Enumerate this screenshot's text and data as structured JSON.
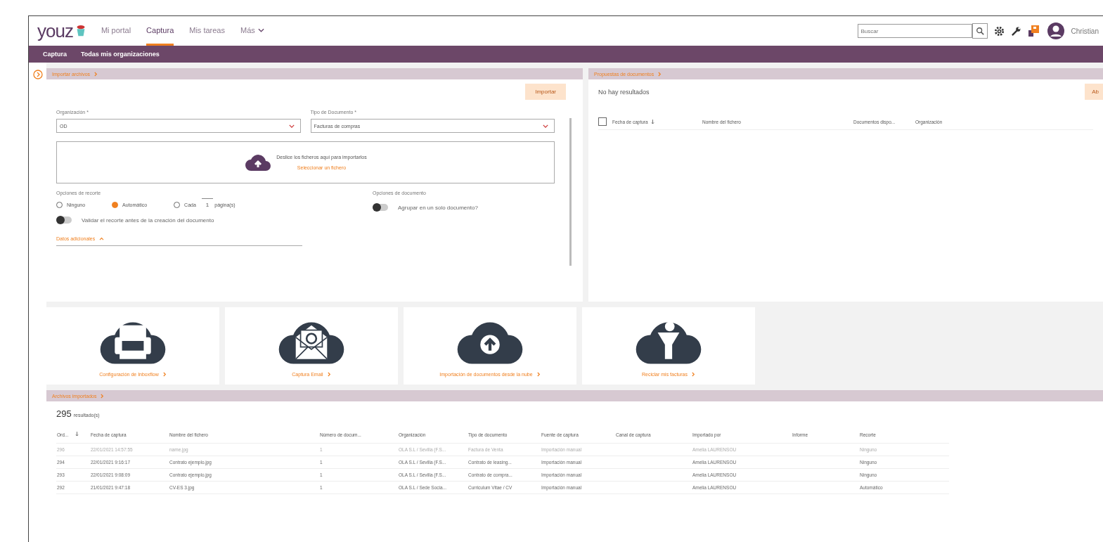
{
  "logo": "youz",
  "top_nav": {
    "items": [
      {
        "label": "Mi portal",
        "selected": false
      },
      {
        "label": "Captura",
        "selected": true
      },
      {
        "label": "Mis tareas",
        "selected": false
      },
      {
        "label": "Más",
        "selected": false
      }
    ],
    "search": {
      "placeholder": "Buscar"
    },
    "user": "Christian"
  },
  "sub_nav": {
    "items": [
      "Captura",
      "Todas mis organizaciones"
    ]
  },
  "import_panel": {
    "title": "Importar archivos",
    "button": "Importar",
    "organization": {
      "label": "Organización *",
      "value": "OD"
    },
    "doc_type": {
      "label": "Tipo de Documento *",
      "value": "Facturas de compras"
    },
    "drop": {
      "text": "Deslice los ficheros aquí para importarlos",
      "link": "Seleccionar un fichero"
    },
    "cut_options": {
      "label": "Opciones de recorte",
      "options": [
        {
          "label": "Ninguno",
          "selected": false
        },
        {
          "label": "Automático",
          "selected": true
        },
        {
          "label": "Cada",
          "selected": false
        }
      ],
      "pages": "1",
      "pages_label": "página(s)"
    },
    "doc_options": {
      "label": "Opciones de documento",
      "toggle": {
        "label": "Agrupar en un solo documento?",
        "on": false
      }
    },
    "validate_toggle": {
      "label": "Validar el recorte antes de la creación del documento",
      "on": false
    },
    "extra": "Datos adicionales"
  },
  "proposals_panel": {
    "title": "Propuestas de documentos",
    "empty": "No hay resultados",
    "button": "Ab",
    "select_all": {
      "checked": false
    },
    "columns": [
      "Fecha de captura",
      "Nombre del fichero",
      "Documentos dispo...",
      "Organización"
    ]
  },
  "cards": [
    {
      "label": "Configuración de Inboxflow"
    },
    {
      "label": "Captura Email"
    },
    {
      "label": "Importación de documentos desde la nube"
    },
    {
      "label": "Reciclar mis facturas"
    }
  ],
  "imported": {
    "title": "Archivos importados",
    "count": "295",
    "count_label": "resultado(s)",
    "columns": [
      "Ord...",
      "Fecha de captura",
      "Nombre del fichero",
      "Número de docum...",
      "Organización",
      "Tipo de documento",
      "Fuente de captura",
      "Canal de captura",
      "Importado por",
      "Informe",
      "Recorte"
    ],
    "rows": [
      [
        "296",
        "22/01/2021 14:57:55",
        "name.jpg",
        "1",
        "OLA S.L / Sevilla (F.S...",
        "Factura de Venta",
        "Importación manual",
        "",
        "Amelia LAURENSOU",
        "",
        "Ninguno"
      ],
      [
        "294",
        "22/01/2021 9:16:17",
        "Contrato ejemplo.jpg",
        "1",
        "OLA S.L / Sevilla (F.S...",
        "Contrato de leasing...",
        "Importación manual",
        "",
        "Amelia LAURENSOU",
        "",
        "Ninguno"
      ],
      [
        "293",
        "22/01/2021 9:08:09",
        "Contrato ejemplo.jpg",
        "1",
        "OLA S.L / Sevilla (F.S...",
        "Contrato de compra...",
        "Importación manual",
        "",
        "Amelia LAURENSOU",
        "",
        "Ninguno"
      ],
      [
        "292",
        "21/01/2021 9:47:18",
        "CV-ES 3.jpg",
        "1",
        "OLA S.L / Sede Socia...",
        "Curriculum Vitae / CV",
        "Importación manual",
        "",
        "Amelia LAURENSOU",
        "",
        "Automático"
      ]
    ]
  }
}
